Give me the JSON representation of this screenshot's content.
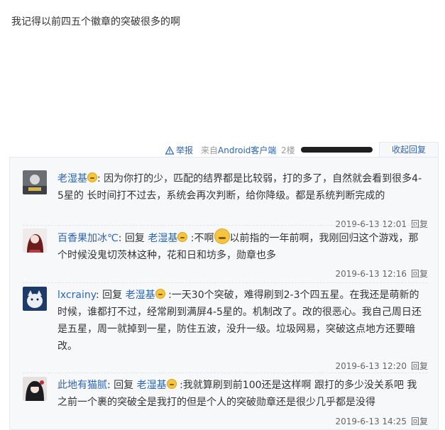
{
  "post": {
    "text": "我记得以前四五个徽章的突破很多的啊"
  },
  "tail": {
    "report": "举报",
    "source_prefix": "来自",
    "source_link": "Android客户端",
    "floor": "2楼",
    "collapse": "收起回复"
  },
  "replies": [
    {
      "user": "老湿基",
      "text": ": 因为你打的少，匹配的结界都是比较弱，打的多了，自然就会看到很多4-5星的 长时间打不过去，系统会再次判断，给你降级。都是系统判断完成的",
      "time": "2019-6-13 12:01",
      "reply": "回复"
    },
    {
      "user": "百香果加冰℃",
      "reply_word": ": 回复 ",
      "target": "老湿基",
      "text_a": " :不啊",
      "text_b": "以前指的一年前啊，我刚回归这个游戏，那个时候没鬼切茨林这种，花和日和坊多，勋章也多",
      "time": "2019-6-13 12:16",
      "reply": "回复"
    },
    {
      "user": "lxcrainy",
      "reply_word": ": 回复 ",
      "target": "老湿基",
      "text": " :一天30个突破，难得刷到2-3个四五星。在我还是萌新的时候，谁都打不过，经常刷到满屏4-5星的。机制改了。改的很恶心。我自己周日还是五星，周一就掉到一星，防住五波，没升一级。垃圾网易，突破这点地方还要暗改。",
      "time": "2019-6-13 12:20",
      "reply": "回复"
    },
    {
      "user": "此地有猫腻",
      "reply_word": ": 回复 ",
      "target": "老湿基",
      "text": " :我就算刷到前100还是这样啊 跟打的多少没关系吧 我之前一个裹的突破全是我打的但是个人的突破勋章还是很少几乎都是没得",
      "time": "2019-6-13 14:25",
      "reply": "回复"
    }
  ],
  "colors": {
    "link": "#2d64b3",
    "muted": "#999999",
    "panel": "#f7f8fa"
  }
}
